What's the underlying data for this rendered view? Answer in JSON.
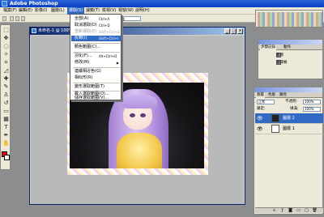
{
  "app": {
    "title": "Adobe Photoshop"
  },
  "menubar": [
    {
      "label": "檔案(F)"
    },
    {
      "label": "編輯(E)"
    },
    {
      "label": "影像(I)"
    },
    {
      "label": "圖層(L)"
    },
    {
      "label": "選取(S)"
    },
    {
      "label": "濾鏡(T)"
    },
    {
      "label": "檢視(V)"
    },
    {
      "label": "視窗(W)"
    },
    {
      "label": "說明(H)"
    }
  ],
  "select_menu": {
    "items": [
      {
        "label": "全部(A)",
        "shortcut": "Ctrl+A",
        "disabled": false
      },
      {
        "label": "取消選取(D)",
        "shortcut": "Ctrl+D",
        "disabled": false
      },
      {
        "label": "重新選取(E)",
        "shortcut": "Shift+Ctrl+D",
        "disabled": true
      },
      {
        "label": "反轉(I)",
        "shortcut": "Shift+Ctrl+I",
        "highlighted": true
      },
      {
        "label": "顏色範圍(C)...",
        "shortcut": ""
      },
      {
        "label": "羽化(F)...",
        "shortcut": "Alt+Ctrl+D"
      },
      {
        "label": "修改(M)",
        "shortcut": "",
        "submenu": true
      },
      {
        "label": "連續相近色(G)",
        "shortcut": ""
      },
      {
        "label": "相似形(R)",
        "shortcut": ""
      },
      {
        "label": "變形選取範圍(T)",
        "shortcut": ""
      },
      {
        "label": "載入選取範圍(O)...",
        "shortcut": ""
      },
      {
        "label": "儲存選取範圍(V)...",
        "shortcut": ""
      }
    ]
  },
  "options": {
    "mode_value": "正常"
  },
  "document": {
    "title": "未命名-1 @ 100% (圖層 2, RGB)"
  },
  "history_panel": {
    "tabs": [
      "步驟記錄",
      "動作"
    ],
    "items": [
      "新增",
      "油漆桶"
    ]
  },
  "layers_panel": {
    "tabs": [
      "圖層",
      "色版",
      "路徑"
    ],
    "blend_mode": "正常",
    "opacity_label": "不透明:",
    "opacity_value": "100%",
    "lock_label": "鎖定:",
    "fill_label": "填滿:",
    "fill_value": "100%",
    "layers": [
      {
        "name": "圖層 2",
        "selected": true
      },
      {
        "name": "圖層 1",
        "selected": false
      }
    ]
  },
  "colors": {
    "foreground": "#ff0000",
    "background": "#ffffff",
    "accent": "#316ac5"
  }
}
